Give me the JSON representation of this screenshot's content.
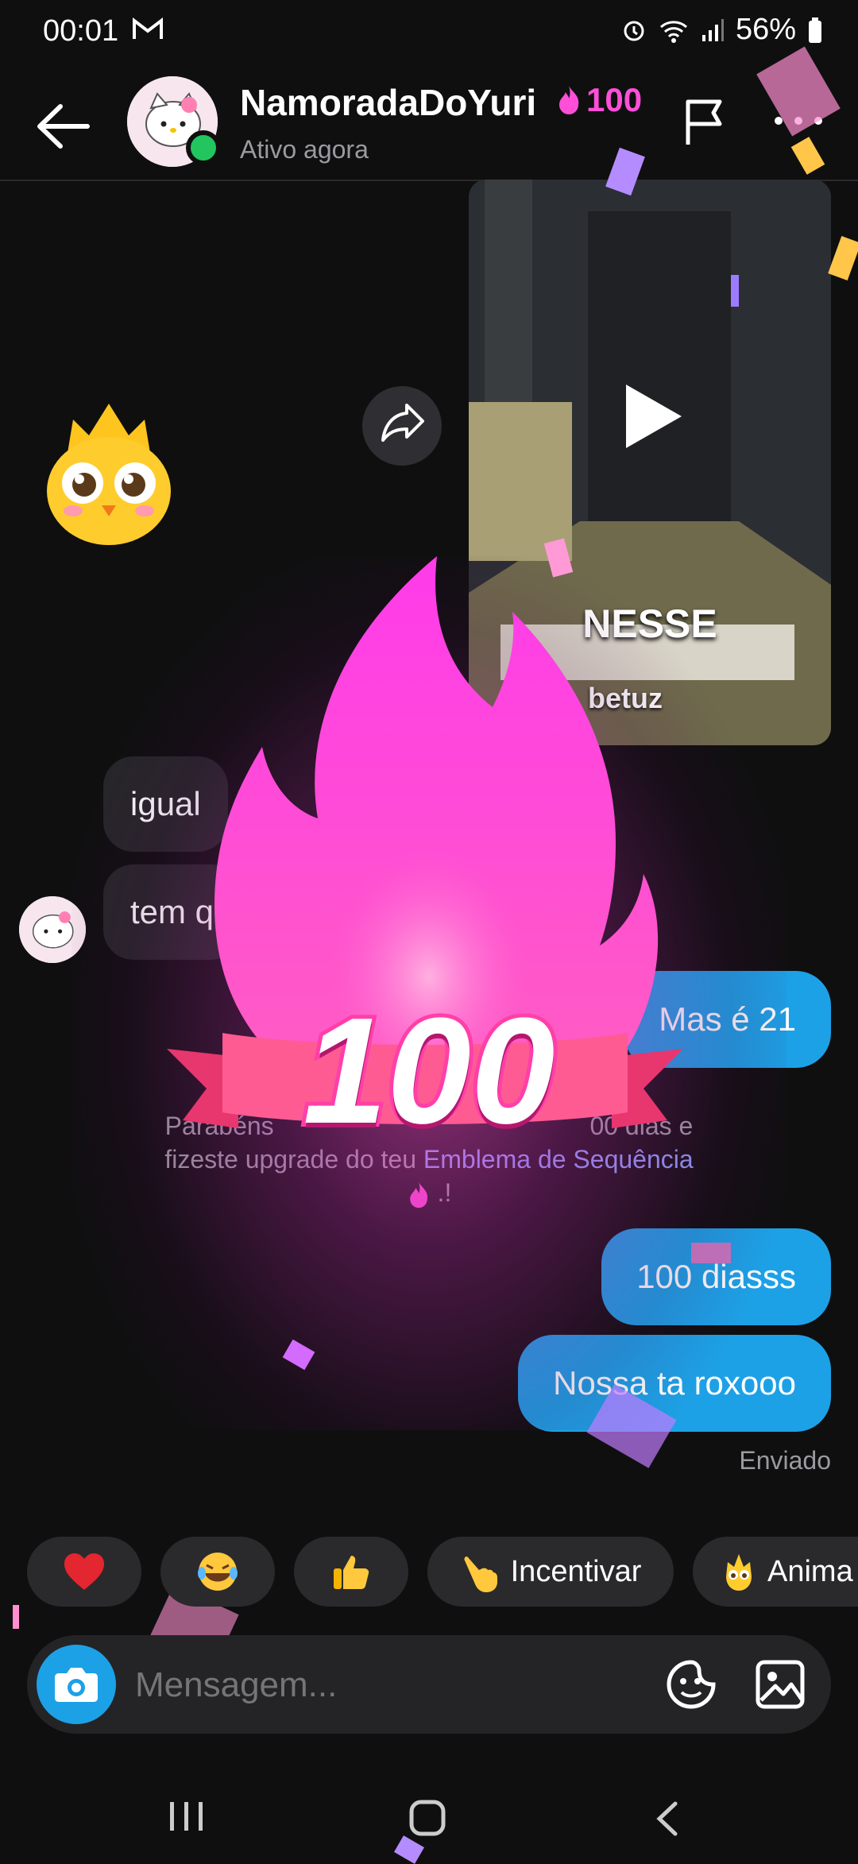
{
  "status_bar": {
    "time": "00:01",
    "battery": "56%"
  },
  "header": {
    "contact_name": "NamoradaDoYuri",
    "streak_count": "100",
    "presence": "Ativo agora"
  },
  "video": {
    "caption": "NESSE",
    "username": "betuz"
  },
  "messages_in": [
    "igual",
    "tem q"
  ],
  "messages_out": [
    "Mas é 21",
    "100 diasss",
    "Nossa ta roxooo"
  ],
  "notice": {
    "line1_start": "Parabéns",
    "line1_end": "00 dias e",
    "line2_start": "fizeste upgrade do teu",
    "link": "Emblema de Sequência",
    "line3": ".!"
  },
  "celebration": {
    "number": "100"
  },
  "delivery_status": "Enviado",
  "reactions": [
    {
      "label": "",
      "icon": "heart-emoji"
    },
    {
      "label": "",
      "icon": "tears-of-joy-emoji"
    },
    {
      "label": "",
      "icon": "thumbs-up-emoji"
    },
    {
      "label": "Incentivar",
      "icon": "pointing-hand-emoji"
    },
    {
      "label": "Anima",
      "icon": "chick-emoji"
    }
  ],
  "composer": {
    "placeholder": "Mensagem..."
  },
  "colors": {
    "accent": "#1da1e6",
    "streak": "#ff4fd8",
    "online": "#22c55e"
  }
}
